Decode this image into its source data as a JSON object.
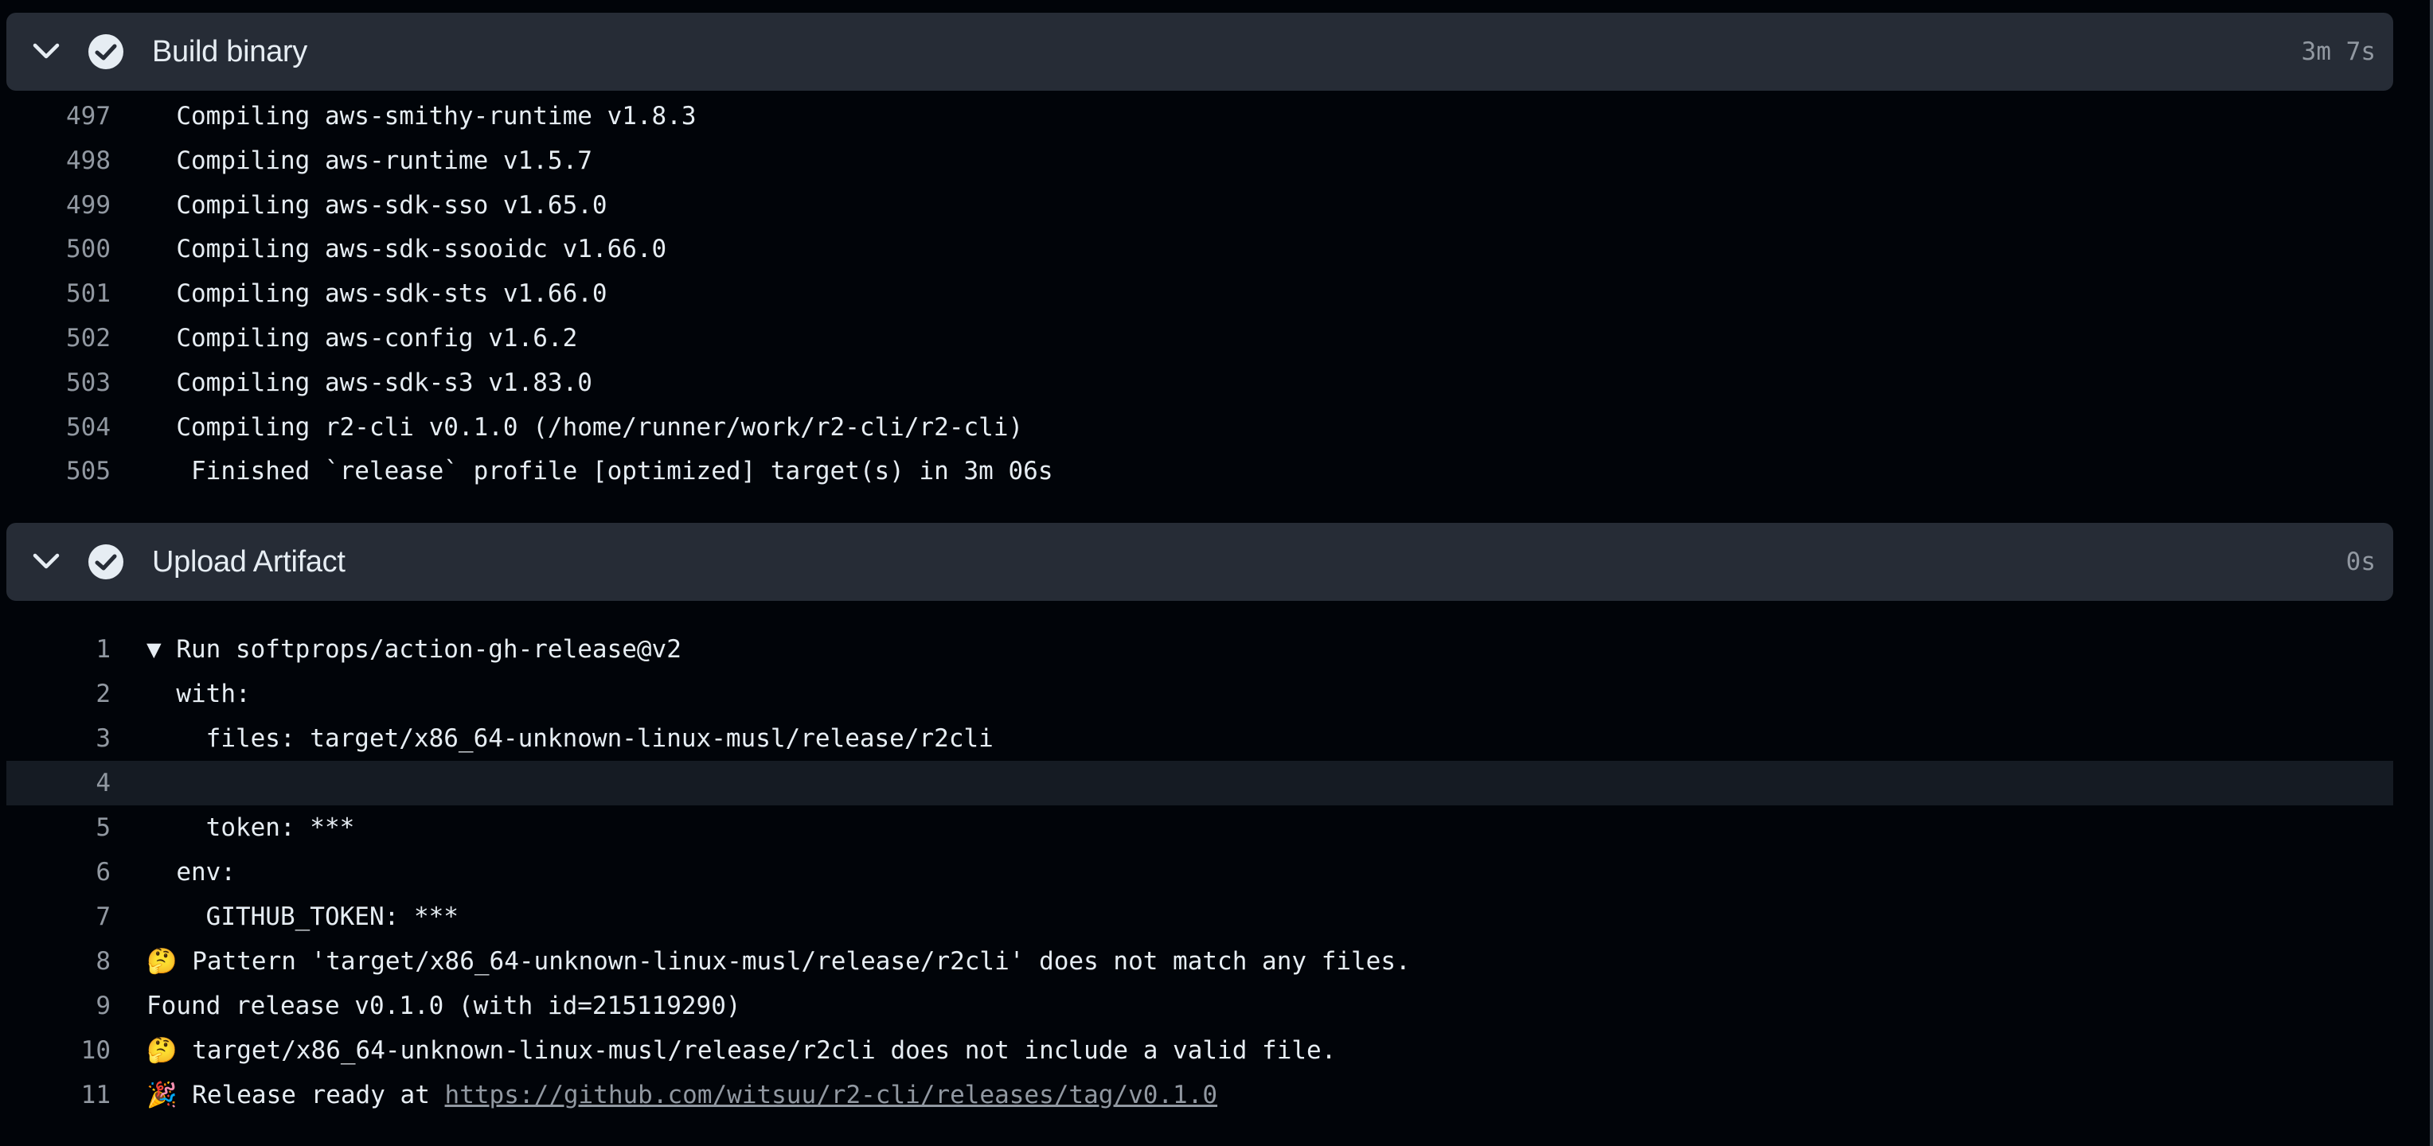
{
  "steps": [
    {
      "title": "Build binary",
      "duration": "3m 7s",
      "lines": [
        {
          "n": "497",
          "text": "  Compiling aws-smithy-runtime v1.8.3"
        },
        {
          "n": "498",
          "text": "  Compiling aws-runtime v1.5.7"
        },
        {
          "n": "499",
          "text": "  Compiling aws-sdk-sso v1.65.0"
        },
        {
          "n": "500",
          "text": "  Compiling aws-sdk-ssooidc v1.66.0"
        },
        {
          "n": "501",
          "text": "  Compiling aws-sdk-sts v1.66.0"
        },
        {
          "n": "502",
          "text": "  Compiling aws-config v1.6.2"
        },
        {
          "n": "503",
          "text": "  Compiling aws-sdk-s3 v1.83.0"
        },
        {
          "n": "504",
          "text": "  Compiling r2-cli v0.1.0 (/home/runner/work/r2-cli/r2-cli)"
        },
        {
          "n": "505",
          "text": "   Finished `release` profile [optimized] target(s) in 3m 06s"
        }
      ]
    },
    {
      "title": "Upload Artifact",
      "duration": "0s",
      "lines": [
        {
          "n": "1",
          "text": "▼ Run softprops/action-gh-release@v2"
        },
        {
          "n": "2",
          "text": "  with:"
        },
        {
          "n": "3",
          "text": "    files: target/x86_64-unknown-linux-musl/release/r2cli"
        },
        {
          "n": "4",
          "text": ""
        },
        {
          "n": "5",
          "text": "    token: ***"
        },
        {
          "n": "6",
          "text": "  env:"
        },
        {
          "n": "7",
          "text": "    GITHUB_TOKEN: ***"
        },
        {
          "n": "8",
          "text": "🤔 Pattern 'target/x86_64-unknown-linux-musl/release/r2cli' does not match any files."
        },
        {
          "n": "9",
          "text": "Found release v0.1.0 (with id=215119290)"
        },
        {
          "n": "10",
          "text": "🤔 target/x86_64-unknown-linux-musl/release/r2cli does not include a valid file."
        },
        {
          "n": "11",
          "text": "🎉 Release ready at ",
          "link": "https://github.com/witsuu/r2-cli/releases/tag/v0.1.0"
        }
      ]
    }
  ],
  "colors": {
    "background": "#010409",
    "header": "#262c36",
    "text": "#e6edf3",
    "muted": "#9198a1",
    "highlight_row": "#151b23"
  },
  "icons": {
    "collapse": "chevron-down-icon",
    "status": "check-circle-icon"
  }
}
